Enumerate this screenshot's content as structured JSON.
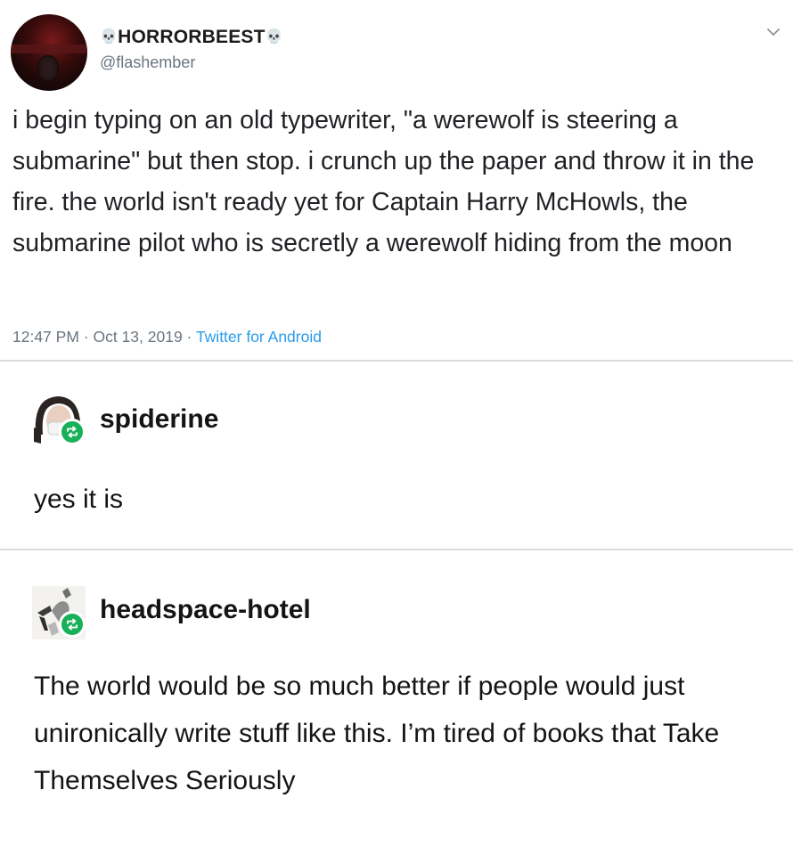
{
  "tweet": {
    "display_name": "HORRORBEEST",
    "handle": "@flashember",
    "text": "i begin typing on an old typewriter, \"a werewolf is steering a submarine\" but then stop. i crunch up the paper and throw it in the fire. the world isn't ready yet for Captain Harry McHowls, the submarine pilot who is secretly a werewolf hiding from the moon",
    "time": "12:47 PM",
    "date": "Oct 13, 2019",
    "source": "Twitter for Android",
    "separator": " · "
  },
  "reblogs": [
    {
      "username": "spiderine",
      "text": "yes it is"
    },
    {
      "username": "headspace-hotel",
      "text": "The world would be so much better if people would just unironically write stuff like this. I’m tired of books that Take Themselves Seriously"
    }
  ],
  "colors": {
    "reblog_badge": "#18b15a",
    "link_blue": "#2b9bea",
    "meta_gray": "#6b7580"
  },
  "icons": {
    "skull": "skull-icon",
    "chevron": "chevron-down-icon",
    "reblog": "reblog-icon"
  }
}
